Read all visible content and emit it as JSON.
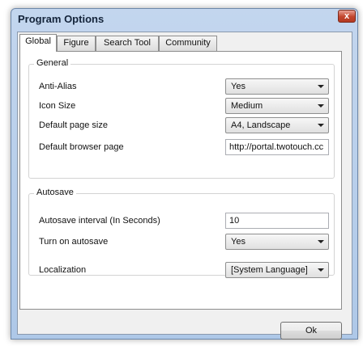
{
  "window": {
    "title": "Program Options",
    "close_glyph": "x"
  },
  "tabs": [
    {
      "label": "Global",
      "active": true
    },
    {
      "label": "Figure",
      "active": false
    },
    {
      "label": "Search Tool",
      "active": false
    },
    {
      "label": "Community",
      "active": false
    }
  ],
  "general": {
    "title": "General",
    "anti_alias": {
      "label": "Anti-Alias",
      "value": "Yes"
    },
    "icon_size": {
      "label": "Icon Size",
      "value": "Medium"
    },
    "page_size": {
      "label": "Default page size",
      "value": "A4, Landscape"
    },
    "browser_page": {
      "label": "Default browser page",
      "value": "http://portal.twotouch.cc"
    }
  },
  "autosave": {
    "title": "Autosave",
    "interval": {
      "label": "Autosave interval (In Seconds)",
      "value": "10"
    },
    "turn_on": {
      "label": "Turn on autosave",
      "value": "Yes"
    }
  },
  "localization": {
    "label": "Localization",
    "value": "[System Language]"
  },
  "buttons": {
    "ok": "Ok"
  }
}
